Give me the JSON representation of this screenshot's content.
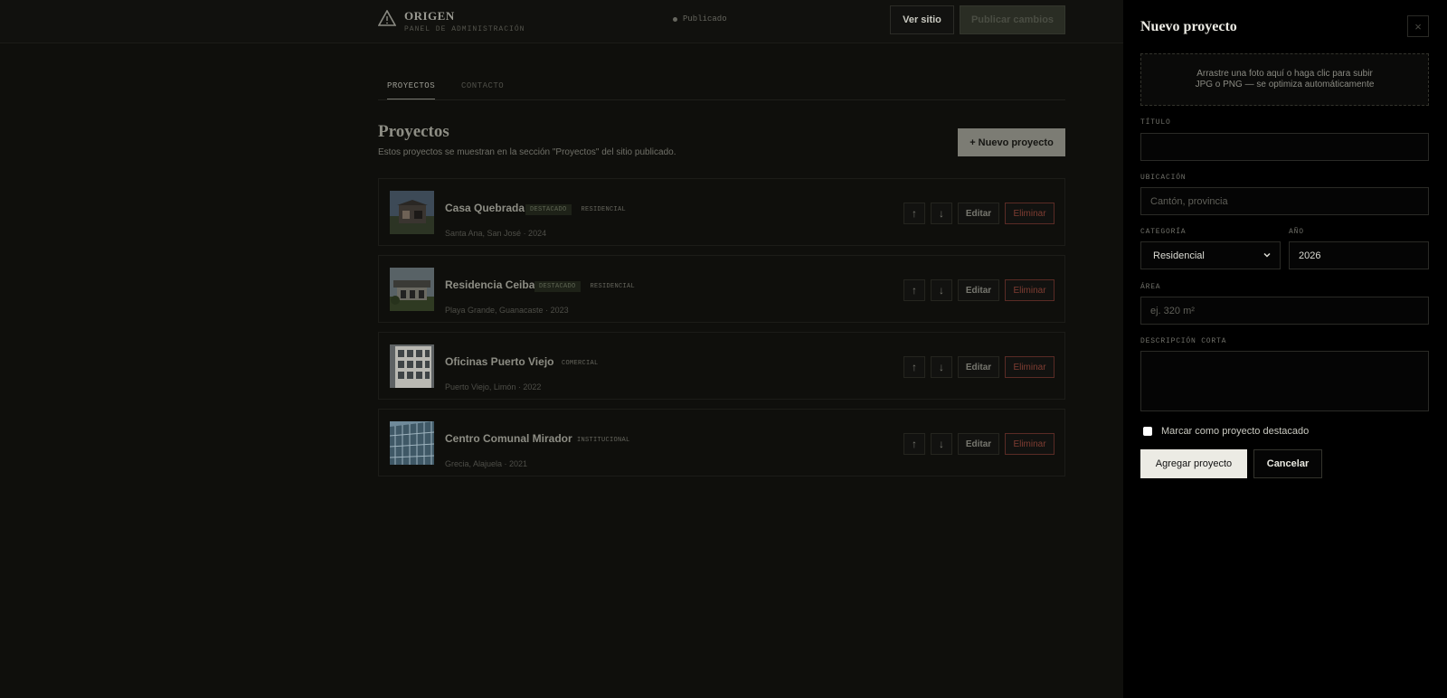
{
  "header": {
    "brand_name": "ORIGEN",
    "brand_subtitle": "PANEL DE ADMINISTRACIÓN",
    "status": "Publicado",
    "view_site": "Ver sitio",
    "publish": "Publicar cambios"
  },
  "tabs": [
    {
      "label": "PROYECTOS",
      "active": true
    },
    {
      "label": "CONTACTO",
      "active": false
    }
  ],
  "main": {
    "title": "Proyectos",
    "description": "Estos proyectos se muestran en la sección \"Proyectos\" del sitio publicado.",
    "new_button": "+ Nuevo proyecto"
  },
  "row_actions": {
    "up": "↑",
    "down": "↓",
    "edit": "Editar",
    "delete": "Eliminar"
  },
  "projects": [
    {
      "title": "Casa Quebrada",
      "featured_badge": "DESTACADO",
      "category": "RESIDENCIAL",
      "meta": "Santa Ana, San José · 2024"
    },
    {
      "title": "Residencia Ceiba",
      "featured_badge": "DESTACADO",
      "category": "RESIDENCIAL",
      "meta": "Playa Grande, Guanacaste · 2023"
    },
    {
      "title": "Oficinas Puerto Viejo",
      "featured_badge": "",
      "category": "COMERCIAL",
      "meta": "Puerto Viejo, Limón · 2022"
    },
    {
      "title": "Centro Comunal Mirador",
      "featured_badge": "",
      "category": "INSTITUCIONAL",
      "meta": "Grecia, Alajuela · 2021"
    }
  ],
  "panel": {
    "title": "Nuevo proyecto",
    "close_icon": "×",
    "dropzone_line1": "Arrastre una foto aquí o haga clic para subir",
    "dropzone_line2": "JPG o PNG — se optimiza automáticamente",
    "fields": {
      "titulo_label": "TÍTULO",
      "titulo_value": "",
      "ubicacion_label": "UBICACIÓN",
      "ubicacion_placeholder": "Cantón, provincia",
      "categoria_label": "CATEGORÍA",
      "categoria_value": "Residencial",
      "anio_label": "AÑO",
      "anio_value": "2026",
      "area_label": "ÁREA",
      "area_placeholder": "ej. 320 m²",
      "descripcion_label": "DESCRIPCIÓN CORTA",
      "descripcion_value": ""
    },
    "featured_checkbox": "Marcar como proyecto destacado",
    "add_button": "Agregar proyecto",
    "cancel_button": "Cancelar"
  },
  "colors": {
    "background": "#0f0f0c",
    "panel": "#000000",
    "danger": "#7f3d32",
    "accent": "#ecebe4"
  }
}
